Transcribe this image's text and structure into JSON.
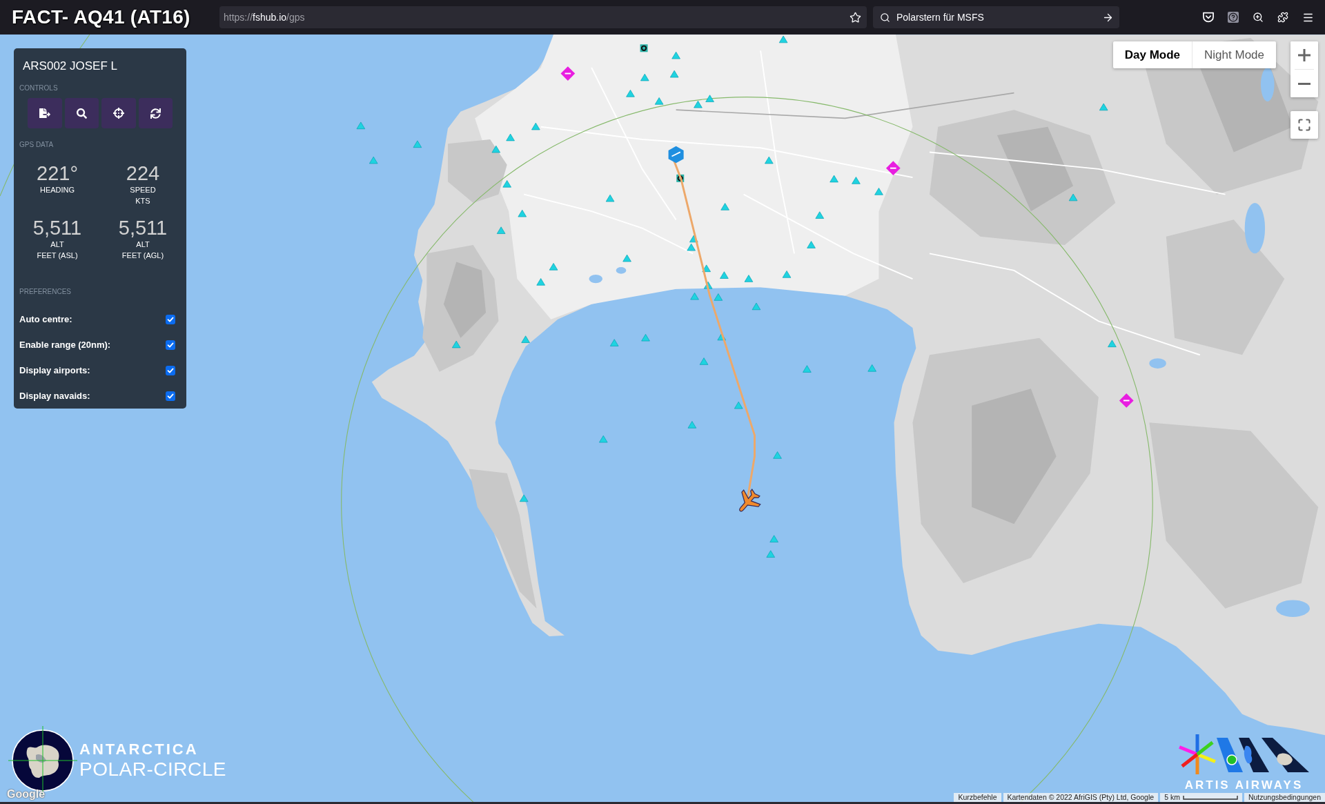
{
  "overlay_title": "FACT- AQ41 (AT16)",
  "browser": {
    "address": {
      "scheme": "https://",
      "domain": "fshub.io",
      "path": "/gps"
    },
    "search": {
      "value": "Polarstern für MSFS"
    }
  },
  "panel": {
    "title": "ARS002 JOSEF L",
    "controls_heading": "CONTROLS",
    "gps_heading": "GPS DATA",
    "stats": [
      {
        "value": "221°",
        "lines": [
          "HEADING"
        ]
      },
      {
        "value": "224",
        "lines": [
          "SPEED",
          "KTS"
        ]
      },
      {
        "value": "5,511",
        "lines": [
          "ALT",
          "FEET (ASL)"
        ]
      },
      {
        "value": "5,511",
        "lines": [
          "ALT",
          "FEET (AGL)"
        ]
      }
    ],
    "preferences_heading": "PREFERENCES",
    "preferences": [
      {
        "label": "Auto centre:",
        "checked": true
      },
      {
        "label": "Enable range (20nm):",
        "checked": true
      },
      {
        "label": "Display airports:",
        "checked": true
      },
      {
        "label": "Display navaids:",
        "checked": true
      }
    ]
  },
  "map_modes": [
    {
      "label": "Day Mode",
      "selected": true
    },
    {
      "label": "Night Mode",
      "selected": false
    }
  ],
  "map": {
    "provider_logo": "Google",
    "attribution": [
      {
        "kind": "link",
        "text": "Kurzbefehle"
      },
      {
        "kind": "text",
        "text": "Kartendaten © 2022 AfriGIS (Pty) Ltd, Google"
      },
      {
        "kind": "scale",
        "text": "5 km"
      },
      {
        "kind": "link",
        "text": "Nutzungsbedingungen"
      }
    ]
  },
  "logos": {
    "left": {
      "line_1": "ANTARCTICA",
      "line_2": "POLAR-CIRCLE"
    },
    "right": {
      "text": "ARTIS AIRWAYS"
    }
  }
}
